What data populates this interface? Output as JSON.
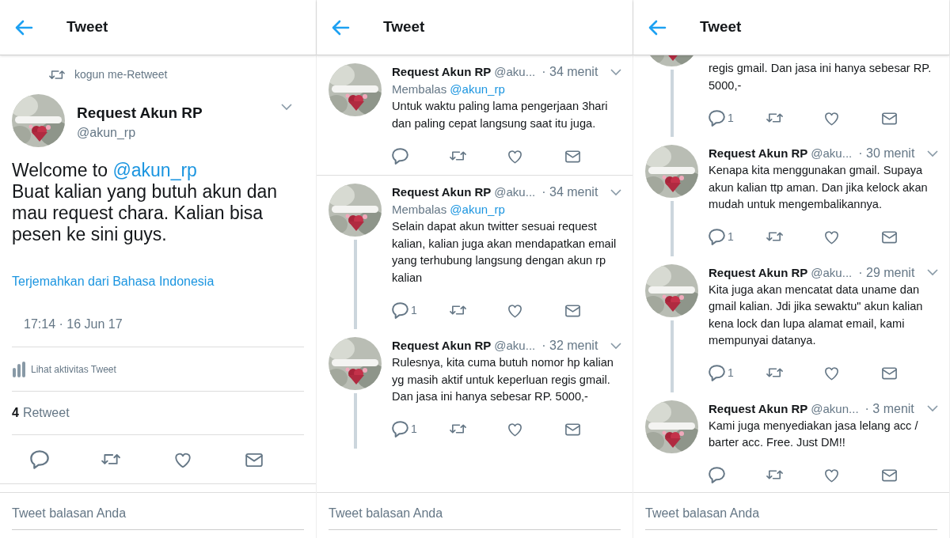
{
  "panels": [
    {
      "kind": "detail",
      "title": "Tweet",
      "retweeted_by": "kogun me-Retweet",
      "author": {
        "name": "Request Akun RP",
        "handle": "@akun_rp"
      },
      "greeting": "Welcome to",
      "mention": "@akun_rp",
      "body": "Buat kalian yang butuh akun dan mau request chara. Kalian bisa pesen ke sini guys.",
      "translate": "Terjemahkan dari Bahasa Indonesia",
      "timestamp": "17:14 · 16 Jun 17",
      "activity": "Lihat aktivitas Tweet",
      "retweet_count": "4",
      "retweet_label": "Retweet",
      "reply_placeholder": "Tweet balasan Anda"
    },
    {
      "kind": "thread",
      "title": "Tweet",
      "reply_placeholder": "Tweet balasan Anda",
      "tweets": [
        {
          "kind": "full",
          "name": "Request Akun RP",
          "handle": "@aku...",
          "time": "· 34 menit",
          "reply_label": "Membalas",
          "reply_to": "@akun_rp",
          "text": "Untuk waktu paling lama pengerjaan 3hari dan paling cepat langsung saat itu juga.",
          "thread_below": false
        },
        {
          "kind": "full",
          "name": "Request Akun RP",
          "handle": "@aku...",
          "time": "· 34 menit",
          "reply_label": "Membalas",
          "reply_to": "@akun_rp",
          "text": "Selain dapat akun twitter sesuai request kalian, kalian juga akan mendapatkan email yang terhubung langsung dengan akun rp kalian",
          "reply_count": "1",
          "thread_below": true
        },
        {
          "kind": "full",
          "name": "Request Akun RP",
          "handle": "@aku...",
          "time": "· 32 menit",
          "text": "Rulesnya, kita cuma butuh nomor hp kalian yg masih aktif untuk keperluan regis gmail. Dan jasa ini hanya sebesar RP. 5000,-",
          "reply_count": "1",
          "thread_below": true
        }
      ]
    },
    {
      "kind": "thread",
      "title": "Tweet",
      "reply_placeholder": "Tweet balasan Anda",
      "tweets": [
        {
          "kind": "cut",
          "text": "regis gmail. Dan jasa ini hanya sebesar RP. 5000,-",
          "reply_count": "1",
          "thread_below": true
        },
        {
          "kind": "full",
          "name": "Request Akun RP",
          "handle": "@aku...",
          "time": "· 30 menit",
          "text": "Kenapa kita menggunakan gmail. Supaya akun kalian ttp aman. Dan jika kelock akan mudah untuk mengembalikannya.",
          "reply_count": "1",
          "thread_below": true
        },
        {
          "kind": "full",
          "name": "Request Akun RP",
          "handle": "@aku...",
          "time": "· 29 menit",
          "text": "Kita juga akan mencatat data uname dan gmail kalian. Jdi jika sewaktu\" akun kalian kena lock dan lupa alamat email, kami mempunyai datanya.",
          "reply_count": "1",
          "thread_below": true
        },
        {
          "kind": "full",
          "name": "Request Akun RP",
          "handle": "@akun...",
          "time": "· 3 menit",
          "text": "Kami juga menyediakan jasa lelang acc / barter acc. Free. Just DM!!",
          "thread_below": false
        }
      ]
    }
  ]
}
